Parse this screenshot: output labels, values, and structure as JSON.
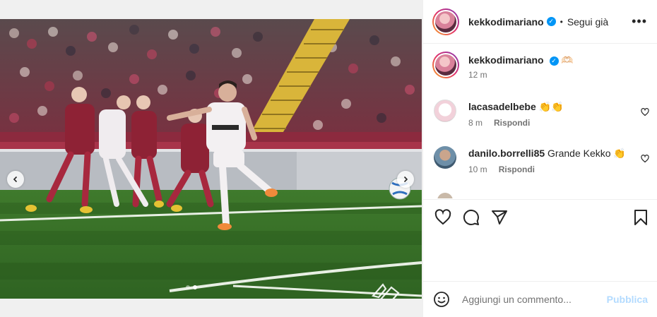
{
  "post": {
    "media_dots": 2,
    "active_dot": 1
  },
  "header": {
    "username": "kekkodimariano",
    "separator": "•",
    "follow_label": "Segui già",
    "more_label": "•••"
  },
  "caption": {
    "username": "kekkodimariano",
    "text": "🫶🏻",
    "time": "12 m"
  },
  "comments": [
    {
      "username": "lacasadelbebe",
      "text": "👏👏",
      "time": "8 m",
      "reply": "Rispondi"
    },
    {
      "username": "danilo.borrelli85",
      "text": "Grande Kekko 👏",
      "time": "10 m",
      "reply": "Rispondi"
    }
  ],
  "add_comment": {
    "placeholder": "Aggiungi un commento...",
    "publish_label": "Pubblica"
  },
  "colors": {
    "verified": "#0095f6",
    "publish": "#b3dbff",
    "home_kit": "#8e2235",
    "away_kit": "#f3f0f2"
  },
  "icons": [
    "chevron-left-icon",
    "chevron-right-icon",
    "heart-icon",
    "comment-icon",
    "share-icon",
    "bookmark-icon",
    "emoji-icon",
    "verified-icon",
    "more-icon",
    "club-logo-watermark"
  ]
}
